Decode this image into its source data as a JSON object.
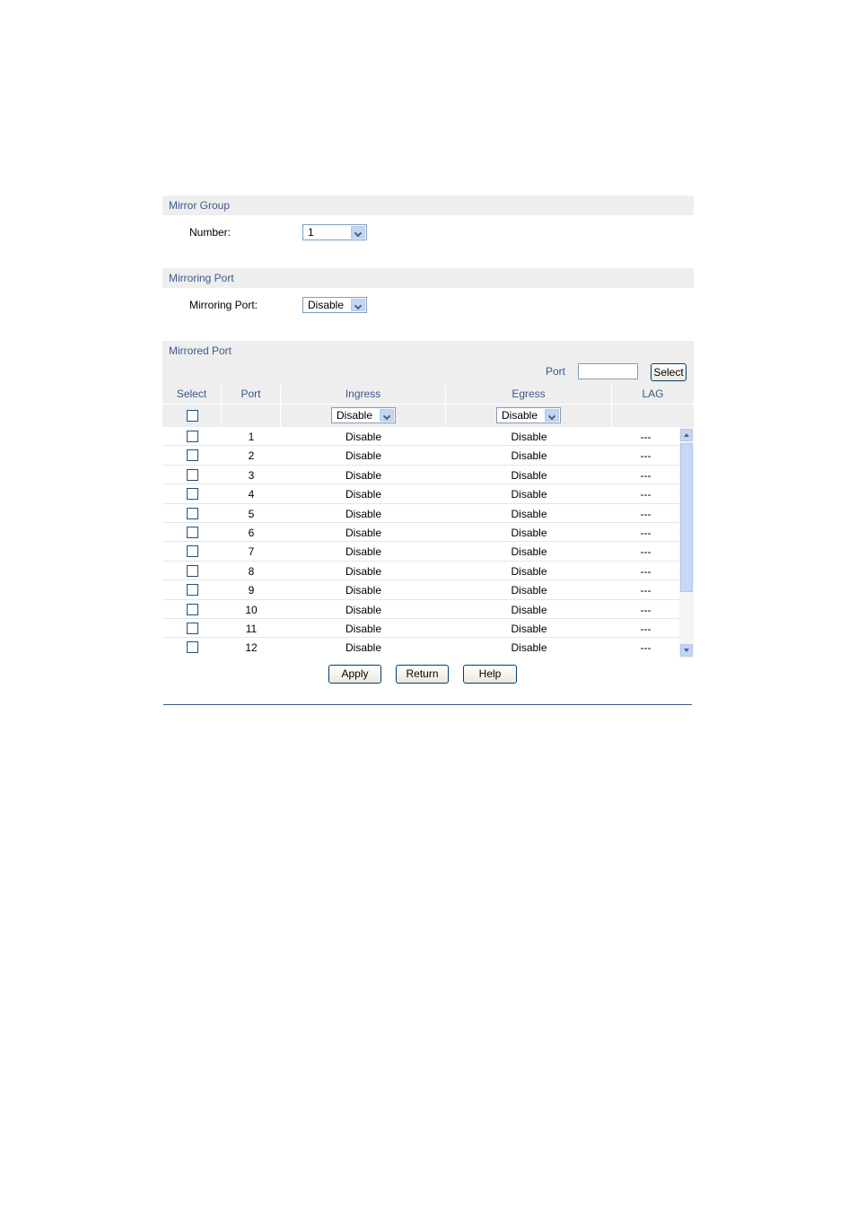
{
  "mirror_group": {
    "header": "Mirror Group",
    "number_label": "Number:",
    "number_value": "1"
  },
  "mirroring_port": {
    "header": "Mirroring Port",
    "label": "Mirroring Port:",
    "value": "Disable"
  },
  "mirrored_port": {
    "header": "Mirrored Port",
    "port_search_label": "Port",
    "port_search_value": "",
    "select_button": "Select",
    "columns": [
      "Select",
      "Port",
      "Ingress",
      "Egress",
      "LAG"
    ],
    "ingress_all": "Disable",
    "egress_all": "Disable",
    "rows": [
      {
        "port": "1",
        "ingress": "Disable",
        "egress": "Disable",
        "lag": "---"
      },
      {
        "port": "2",
        "ingress": "Disable",
        "egress": "Disable",
        "lag": "---"
      },
      {
        "port": "3",
        "ingress": "Disable",
        "egress": "Disable",
        "lag": "---"
      },
      {
        "port": "4",
        "ingress": "Disable",
        "egress": "Disable",
        "lag": "---"
      },
      {
        "port": "5",
        "ingress": "Disable",
        "egress": "Disable",
        "lag": "---"
      },
      {
        "port": "6",
        "ingress": "Disable",
        "egress": "Disable",
        "lag": "---"
      },
      {
        "port": "7",
        "ingress": "Disable",
        "egress": "Disable",
        "lag": "---"
      },
      {
        "port": "8",
        "ingress": "Disable",
        "egress": "Disable",
        "lag": "---"
      },
      {
        "port": "9",
        "ingress": "Disable",
        "egress": "Disable",
        "lag": "---"
      },
      {
        "port": "10",
        "ingress": "Disable",
        "egress": "Disable",
        "lag": "---"
      },
      {
        "port": "11",
        "ingress": "Disable",
        "egress": "Disable",
        "lag": "---"
      },
      {
        "port": "12",
        "ingress": "Disable",
        "egress": "Disable",
        "lag": "---"
      }
    ]
  },
  "actions": {
    "apply": "Apply",
    "return": "Return",
    "help": "Help"
  },
  "colors": {
    "header_text": "#3a5a8c",
    "header_bg": "#eeeeee"
  }
}
